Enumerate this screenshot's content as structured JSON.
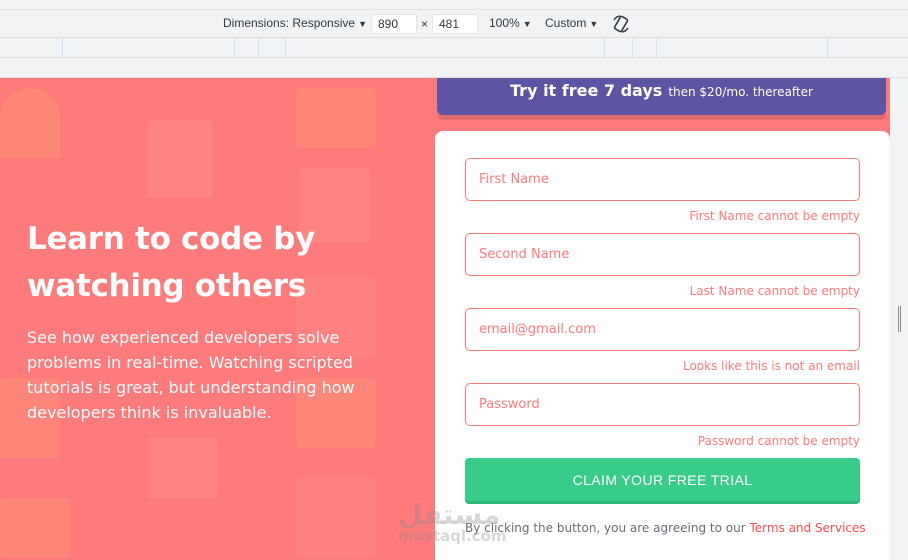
{
  "devtools": {
    "dimensions_label": "Dimensions: Responsive",
    "width": "890",
    "times": "×",
    "height": "481",
    "zoom": "100%",
    "throttle": "Custom"
  },
  "hero": {
    "title": "Learn to code by watching others",
    "text": "See how experienced developers solve problems in real-time. Watching scripted tutorials is great, but understanding how developers think is invaluable."
  },
  "banner": {
    "strong": "Try it free 7 days",
    "rest": "then $20/mo. thereafter"
  },
  "form": {
    "first_name": {
      "placeholder": "First Name",
      "error": "First Name cannot be empty"
    },
    "second_name": {
      "placeholder": "Second Name",
      "error": "Last Name cannot be empty"
    },
    "email": {
      "placeholder": "email@gmail.com",
      "error": "Looks like this is not an email"
    },
    "password": {
      "placeholder": "Password",
      "error": "Password cannot be empty"
    },
    "submit_label": "CLAIM YOUR FREE TRIAL",
    "terms_prefix": "By clicking the button, you are agreeing to our",
    "terms_link": "Terms and Services"
  },
  "watermark": {
    "arabic": "مستقل",
    "latin": "mostaql.com"
  },
  "colors": {
    "primary_red": "#ff7a7a",
    "banner_purple": "#5e54a4",
    "submit_green": "#38cc8b"
  }
}
